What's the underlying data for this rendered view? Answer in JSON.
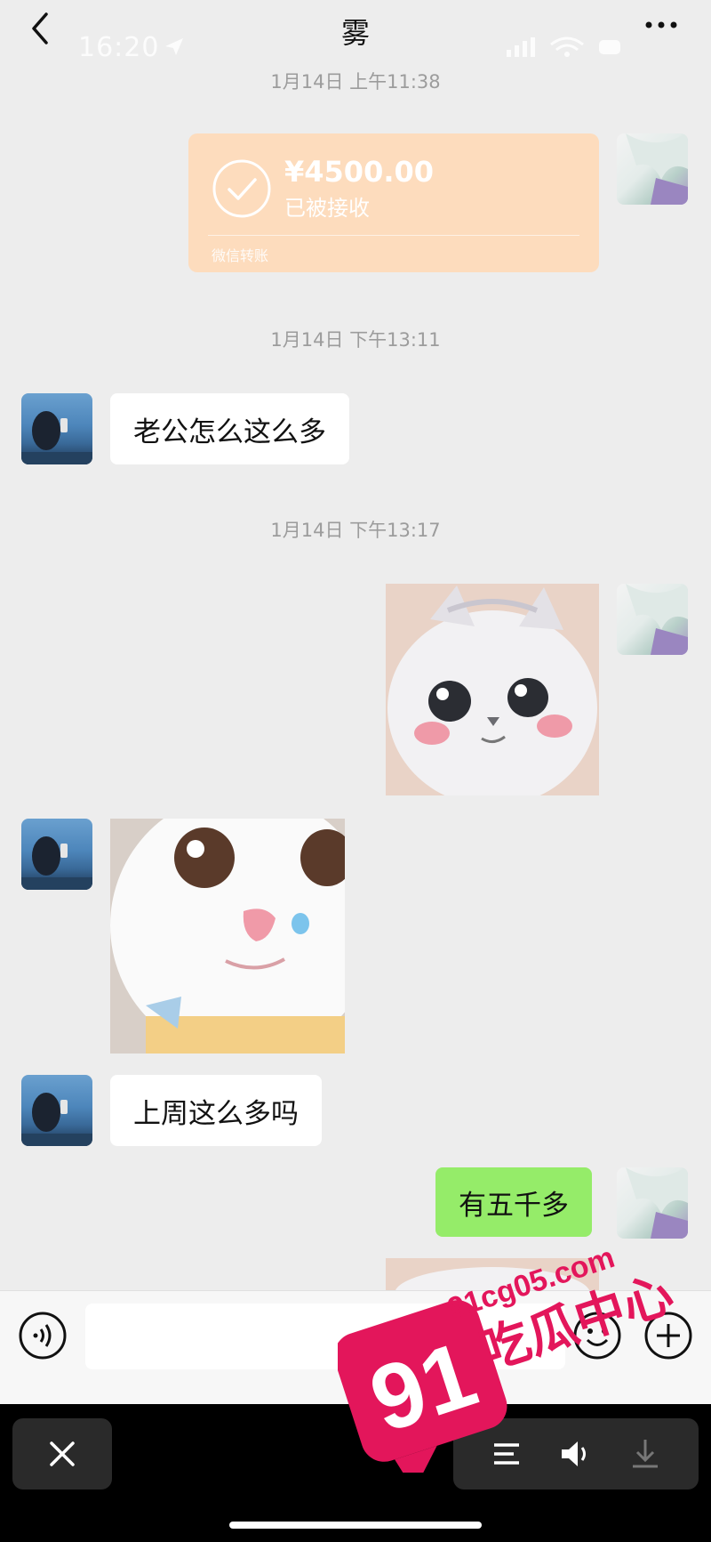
{
  "status_bar": {
    "time": "16:20"
  },
  "header": {
    "title": "雾",
    "back_icon": "chevron-left-icon",
    "more_icon": "more-dots-icon"
  },
  "messages": {
    "ts1": "1月14日 上午11:38",
    "transfer": {
      "amount": "¥4500.00",
      "status": "已被接收",
      "footer": "微信转账"
    },
    "ts2": "1月14日 下午13:11",
    "msg1": "老公怎么这么多",
    "ts3": "1月14日 下午13:17",
    "msg2": "上周这么多吗",
    "msg3": "有五千多"
  },
  "input_bar": {
    "voice_icon": "voice-icon",
    "emoji_icon": "emoji-icon",
    "plus_icon": "plus-icon"
  },
  "viewer_bar": {
    "close_icon": "close-icon",
    "menu_icon": "menu-icon",
    "speaker_icon": "speaker-icon",
    "download_icon": "download-icon"
  },
  "watermark": {
    "number": "91",
    "domain": "91cg05.com",
    "name": "吃瓜中心"
  },
  "colors": {
    "bubble_right": "#95ec69",
    "bubble_left": "#ffffff",
    "transfer": "#fddcbd",
    "background": "#ededed",
    "watermark": "#e3165b"
  }
}
